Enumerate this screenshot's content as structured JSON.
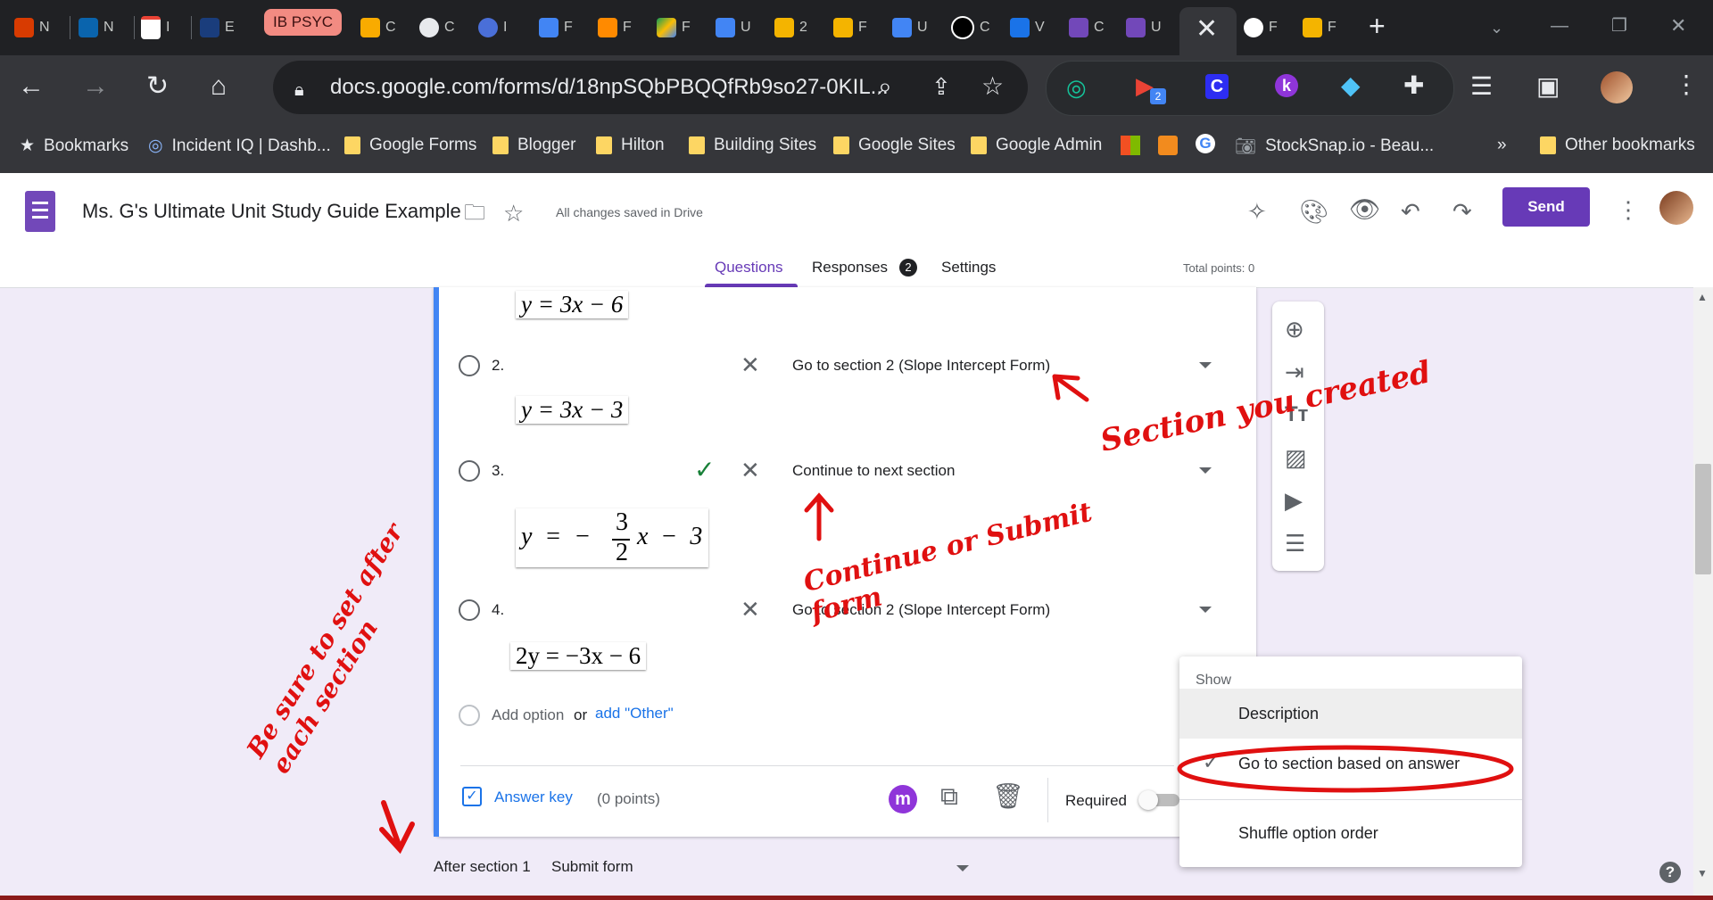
{
  "browser": {
    "tabs": [
      "N",
      "N",
      "I",
      "E",
      "IB PSYC",
      "C",
      "C",
      "I",
      "F",
      "F",
      "F",
      "U",
      "2",
      "F",
      "U",
      "C",
      "V",
      "C",
      "U",
      "F",
      "F"
    ],
    "new_tab": "+",
    "url": "docs.google.com/forms/d/18npSQbPBQQfRb9so27-0KIL...",
    "ext_badge": "2",
    "bookmarks": [
      "Bookmarks",
      "Incident IQ | Dashb...",
      "Google Forms",
      "Blogger",
      "Hilton",
      "Building Sites",
      "Google Sites",
      "Google Admin",
      "StockSnap.io - Beau..."
    ],
    "overflow": "»",
    "other_bookmarks": "Other bookmarks"
  },
  "form": {
    "title": "Ms. G's Ultimate Unit Study Guide Example",
    "saved": "All changes saved in Drive",
    "send": "Send",
    "tabs": {
      "questions": "Questions",
      "responses": "Responses",
      "responses_count": "2",
      "settings": "Settings"
    },
    "total_points": "Total points: 0"
  },
  "question": {
    "equation_top": "y = 3x − 6",
    "options": [
      {
        "num": "2.",
        "goto": "Go to section 2 (Slope Intercept Form)",
        "equation": "y = 3x − 3"
      },
      {
        "num": "3.",
        "goto": "Continue to next section"
      },
      {
        "num": "4.",
        "goto": "Go to section 2 (Slope Intercept Form)",
        "equation": "2y = −3x − 6"
      }
    ],
    "frac": {
      "lhs": "y  =  −",
      "num": "3",
      "den": "2",
      "rhs": "x  −  3"
    },
    "add_option": "Add option",
    "or": "or",
    "add_other": "add \"Other\"",
    "answer_key": "Answer key",
    "points": "(0 points)",
    "required": "Required"
  },
  "menu": {
    "header": "Show",
    "items": [
      "Description",
      "Go to section based on answer",
      "Shuffle option order"
    ]
  },
  "footer": {
    "after": "After section 1",
    "submit": "Submit form"
  },
  "annotations": {
    "section": "Section you created",
    "continue": "Continue or Submit form",
    "side": "Be sure to set after each section"
  }
}
